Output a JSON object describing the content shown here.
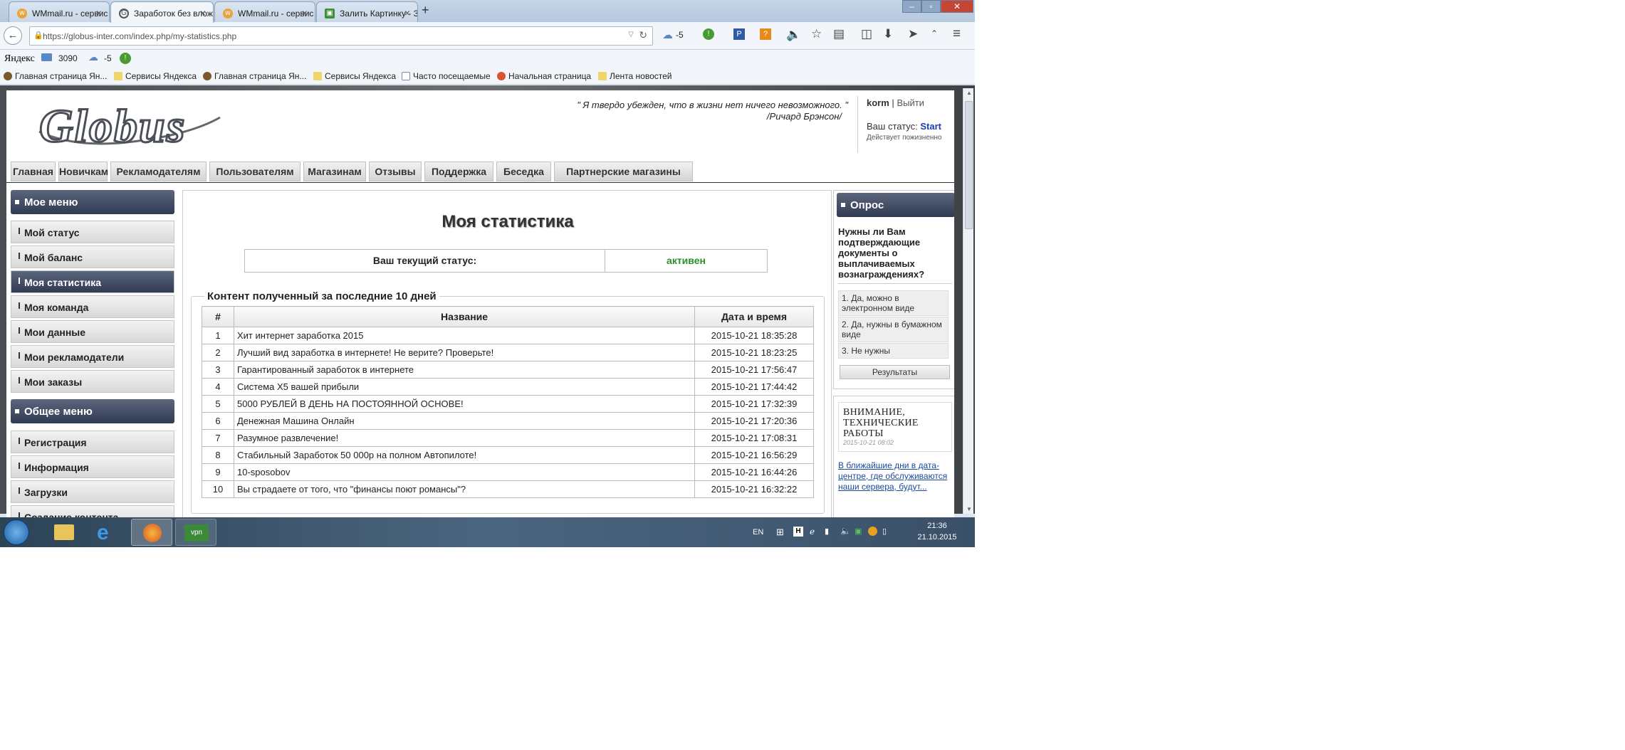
{
  "browser": {
    "tabs": [
      {
        "title": "WMmail.ru - сервис почт...",
        "active": false
      },
      {
        "title": "Заработок без вложений ...",
        "active": true
      },
      {
        "title": "WMmail.ru - сервис почт...",
        "active": false
      },
      {
        "title": "Залить Картинку - Загруз...",
        "active": false
      }
    ],
    "new_tab": "+",
    "url": "https://globus-inter.com/index.php/my-statistics.php",
    "weather_temp": "-5"
  },
  "yandex_bar": {
    "logo": "Яндекс",
    "mail_count": "3090",
    "weather": "-5"
  },
  "bookmarks": [
    "Главная страница Ян...",
    "Сервисы Яндекса",
    "Главная страница Ян...",
    "Сервисы Яндекса",
    "Часто посещаемые",
    "Начальная страница",
    "Лента новостей"
  ],
  "site": {
    "logo_text": "Globus",
    "quote": "\" Я твердо убежден, что в жизни нет ничего невозможного. \"",
    "quote_author": "/Ричард Брэнсон/",
    "user": {
      "name": "korm",
      "separator": "|",
      "logout": "Выйти",
      "status_label": "Ваш статус:",
      "status_value": "Start",
      "status_note": "Действует пожизненно"
    },
    "menu": [
      "Главная",
      "Новичкам",
      "Рекламодателям",
      "Пользователям",
      "Магазинам",
      "Отзывы",
      "Поддержка",
      "Беседка",
      "Партнерские магазины"
    ]
  },
  "sidebar": {
    "my_menu_title": "Мое меню",
    "my_menu": [
      "Мой статус",
      "Мой баланс",
      "Моя статистика",
      "Моя команда",
      "Мои данные",
      "Мои рекламодатели",
      "Мои заказы"
    ],
    "active_index": 2,
    "general_menu_title": "Общее меню",
    "general_menu": [
      "Регистрация",
      "Информация",
      "Загрузки",
      "Создание контента"
    ]
  },
  "main": {
    "title": "Моя статистика",
    "status_label": "Ваш текущий статус:",
    "status_value": "активен",
    "content_legend": "Контент полученный за последние 10 дней",
    "table": {
      "headers": [
        "#",
        "Название",
        "Дата и время"
      ],
      "rows": [
        [
          "1",
          "Хит интернет заработка 2015",
          "2015-10-21 18:35:28"
        ],
        [
          "2",
          "Лучший вид заработка в интернете! Не верите? Проверьте!",
          "2015-10-21 18:23:25"
        ],
        [
          "3",
          "Гарантированный заработок в интернете",
          "2015-10-21 17:56:47"
        ],
        [
          "4",
          "Система X5 вашей прибыли",
          "2015-10-21 17:44:42"
        ],
        [
          "5",
          "5000 РУБЛЕЙ В ДЕНЬ НА ПОСТОЯННОЙ ОСНОВЕ!",
          "2015-10-21 17:32:39"
        ],
        [
          "6",
          "Денежная Машина Онлайн",
          "2015-10-21 17:20:36"
        ],
        [
          "7",
          "Разумное развлечение!",
          "2015-10-21 17:08:31"
        ],
        [
          "8",
          "Стабильный Заработок 50 000р на полном Автопилоте!",
          "2015-10-21 16:56:29"
        ],
        [
          "9",
          "10-sposobov",
          "2015-10-21 16:44:26"
        ],
        [
          "10",
          "Вы страдаете от того, что \"финансы поют романсы\"?",
          "2015-10-21 16:32:22"
        ]
      ]
    }
  },
  "poll": {
    "title": "Опрос",
    "question": "Нужны ли Вам подтверждающие документы о выплачиваемых вознаграждениях?",
    "answers": [
      "1. Да, можно в электронном виде",
      "2. Да, нужны в бумажном виде",
      "3. Не нужны"
    ],
    "results": "Результаты"
  },
  "news": {
    "title": "ВНИМАНИЕ, ТЕХНИЧЕСКИЕ РАБОТЫ",
    "date": "2015-10-21 08:02",
    "link": "В ближайшие дни в дата-центре, где обслуживаются наши сервера, будут..."
  },
  "taskbar": {
    "lang": "EN",
    "time": "21:36",
    "date": "21.10.2015",
    "vpn_label": "vpn"
  }
}
